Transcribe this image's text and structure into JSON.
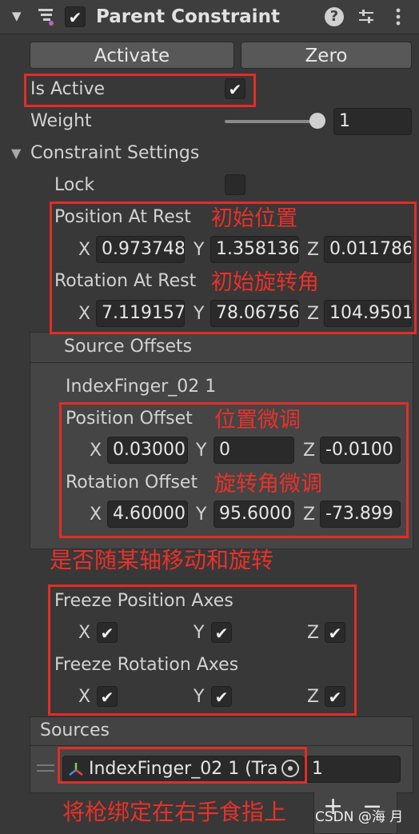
{
  "header": {
    "title": "Parent Constraint",
    "enabled": true,
    "icons": [
      "foldout-arrow-icon",
      "constraint-component-icon",
      "help-icon",
      "preset-icon",
      "kebab-menu-icon"
    ]
  },
  "buttons": {
    "activate": "Activate",
    "zero": "Zero"
  },
  "is_active": {
    "label": "Is Active",
    "checked": true
  },
  "weight": {
    "label": "Weight",
    "value": "1",
    "slider_fraction": 1.0
  },
  "constraint_settings": {
    "label": "Constraint Settings",
    "lock": {
      "label": "Lock",
      "checked": false
    },
    "position_at_rest": {
      "label": "Position At Rest",
      "x": "0.973748",
      "y": "1.358136",
      "z": "0.011786"
    },
    "rotation_at_rest": {
      "label": "Rotation At Rest",
      "x": "7.119157",
      "y": "78.06756",
      "z": "104.9501"
    },
    "axis_labels": {
      "x": "X",
      "y": "Y",
      "z": "Z"
    }
  },
  "source_offsets": {
    "label": "Source Offsets",
    "source_name": "IndexFinger_02 1",
    "position_offset": {
      "label": "Position Offset",
      "x": "0.03000",
      "y": "0",
      "z": "-0.0100"
    },
    "rotation_offset": {
      "label": "Rotation Offset",
      "x": "4.60000",
      "y": "95.6000",
      "z": "-73.899"
    }
  },
  "freeze": {
    "position_label": "Freeze Position Axes",
    "rotation_label": "Freeze Rotation Axes",
    "position": {
      "x": true,
      "y": true,
      "z": true
    },
    "rotation": {
      "x": true,
      "y": true,
      "z": true
    }
  },
  "sources": {
    "label": "Sources",
    "item": {
      "object": "IndexFinger_02 1 (Tra",
      "weight": "1"
    },
    "add_label": "+",
    "remove_label": "−"
  },
  "annotations": {
    "pos_rest": "初始位置",
    "rot_rest": "初始旋转角",
    "pos_offset": "位置微调",
    "rot_offset": "旋转角微调",
    "follow": "是否随某轴移动和旋转",
    "sources": "将枪绑定在右手食指上"
  },
  "watermark": "CSDN @海 月",
  "colors": {
    "annotation_red": "#e22d27",
    "background": "#383838",
    "field": "#2a2a2a"
  }
}
